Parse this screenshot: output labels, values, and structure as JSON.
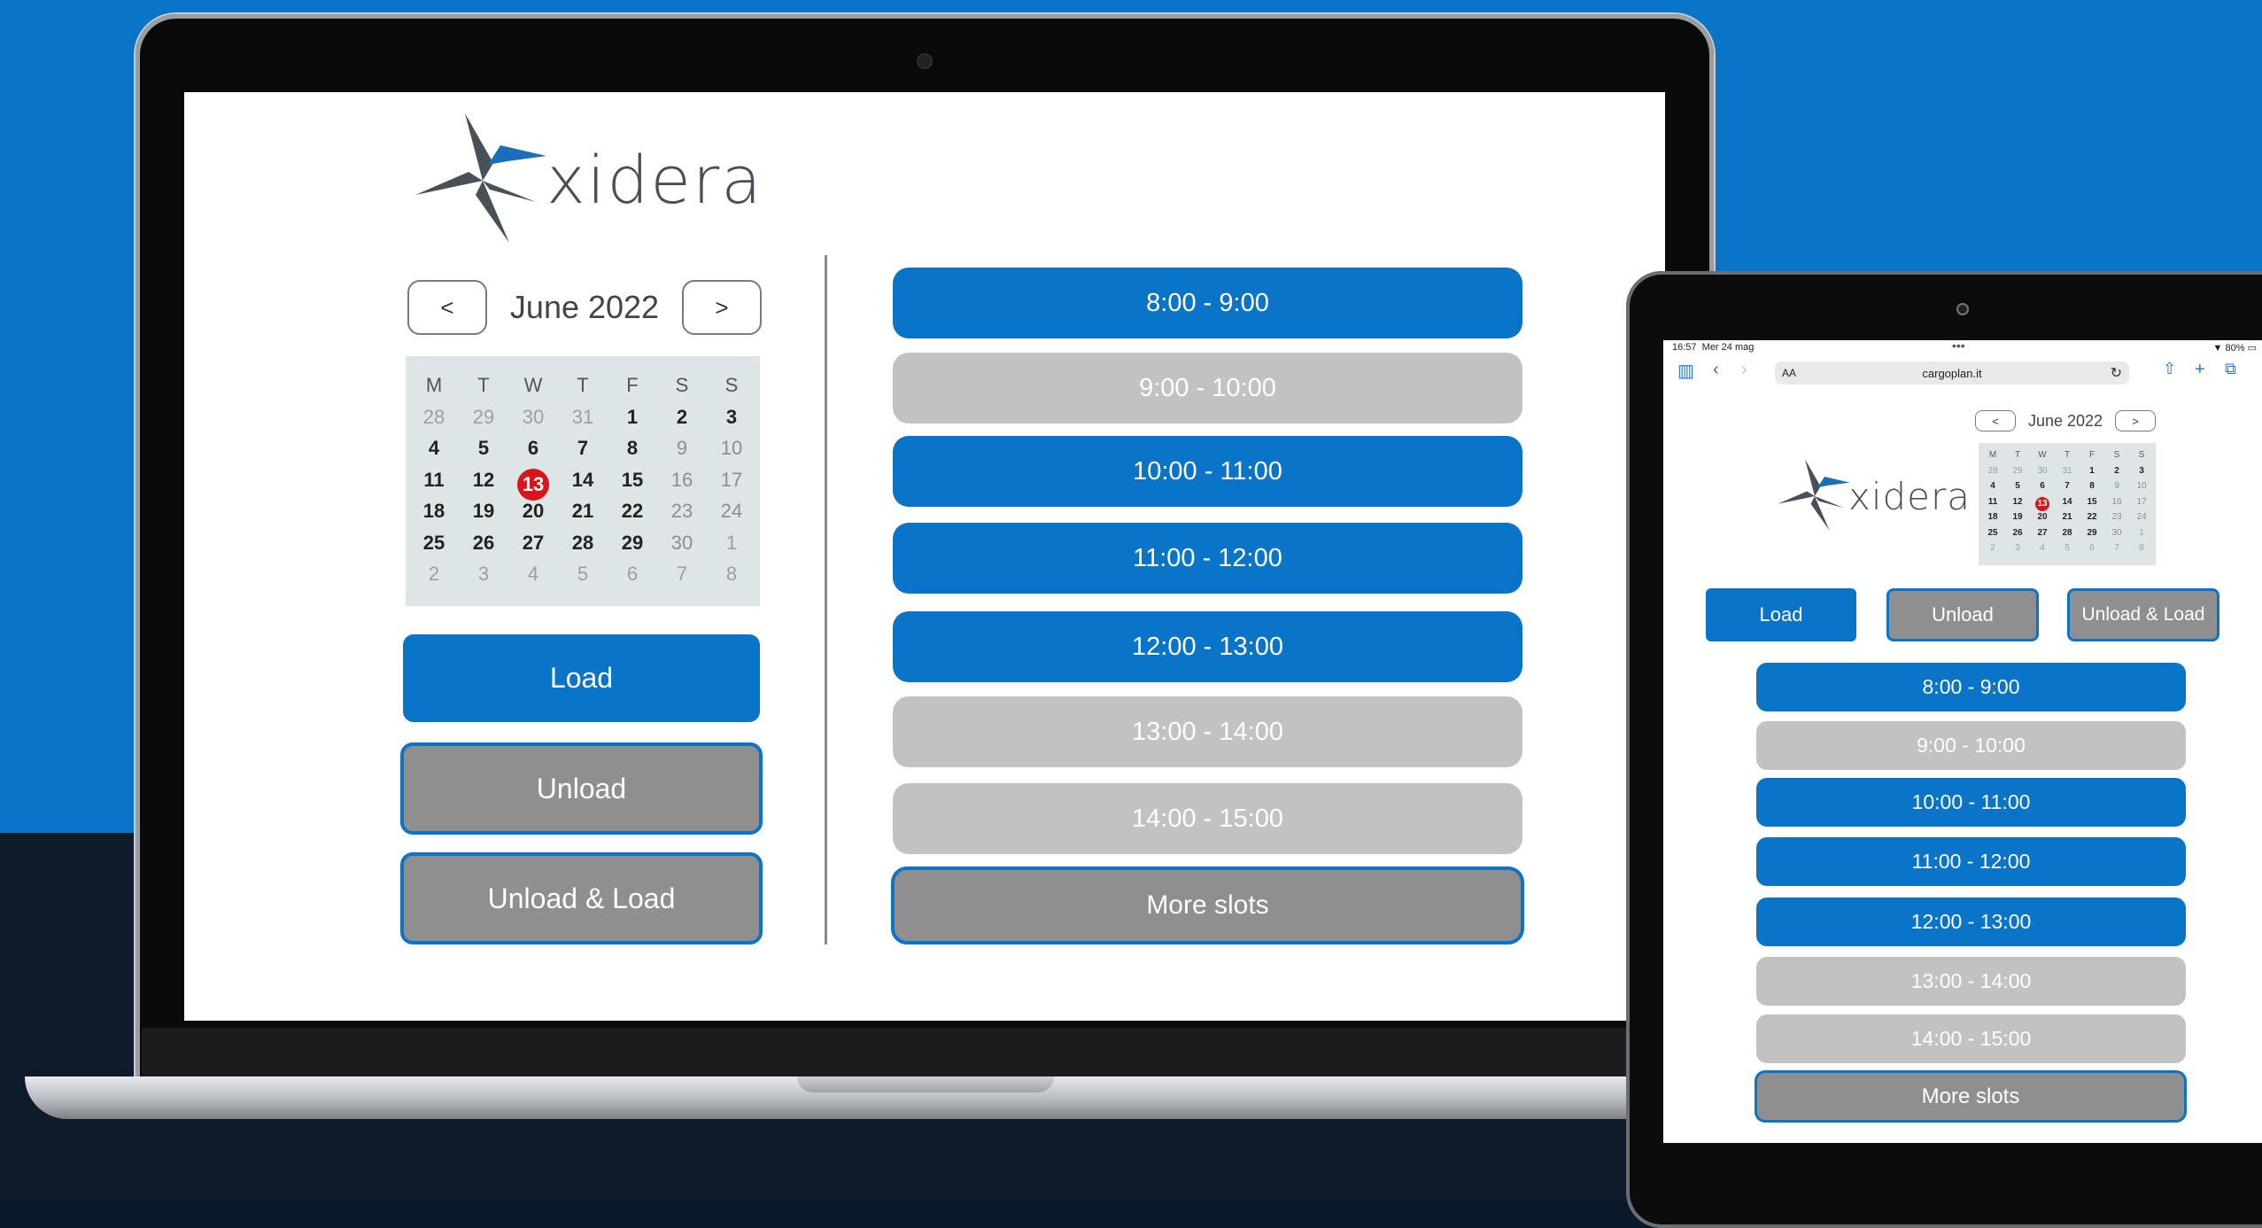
{
  "colors": {
    "accent": "#0a74c9",
    "slot_available": "#0a74c9",
    "slot_unavailable": "#c2c2c2",
    "selected_day": "#d9141b",
    "button_grey": "#8f8f8f"
  },
  "brand": {
    "logo_text": "xidera"
  },
  "calendar": {
    "prev_label": "<",
    "next_label": ">",
    "month_label": "June 2022",
    "weekdays": [
      "M",
      "T",
      "W",
      "T",
      "F",
      "S",
      "S"
    ],
    "weeks": [
      [
        "28",
        "29",
        "30",
        "31",
        "1",
        "2",
        "3"
      ],
      [
        "4",
        "5",
        "6",
        "7",
        "8",
        "9",
        "10"
      ],
      [
        "11",
        "12",
        "13",
        "14",
        "15",
        "16",
        "17"
      ],
      [
        "18",
        "19",
        "20",
        "21",
        "22",
        "23",
        "24"
      ],
      [
        "25",
        "26",
        "27",
        "28",
        "29",
        "30",
        "1"
      ],
      [
        "2",
        "3",
        "4",
        "5",
        "6",
        "7",
        "8"
      ]
    ],
    "today": "13"
  },
  "operations": {
    "load": "Load",
    "unload": "Unload",
    "unload_load": "Unload & Load"
  },
  "slots": [
    {
      "label": "8:00 - 9:00",
      "available": true
    },
    {
      "label": "9:00 - 10:00",
      "available": false
    },
    {
      "label": "10:00 - 11:00",
      "available": true
    },
    {
      "label": "11:00 - 12:00",
      "available": true
    },
    {
      "label": "12:00 - 13:00",
      "available": true
    },
    {
      "label": "13:00 - 14:00",
      "available": false
    },
    {
      "label": "14:00 - 15:00",
      "available": false
    }
  ],
  "more_slots": "More slots",
  "tablet": {
    "time": "16:57",
    "date": "Mer 24 mag",
    "dots": "•••",
    "battery": "80%",
    "url_aa": "AA",
    "url": "cargoplan.it"
  }
}
